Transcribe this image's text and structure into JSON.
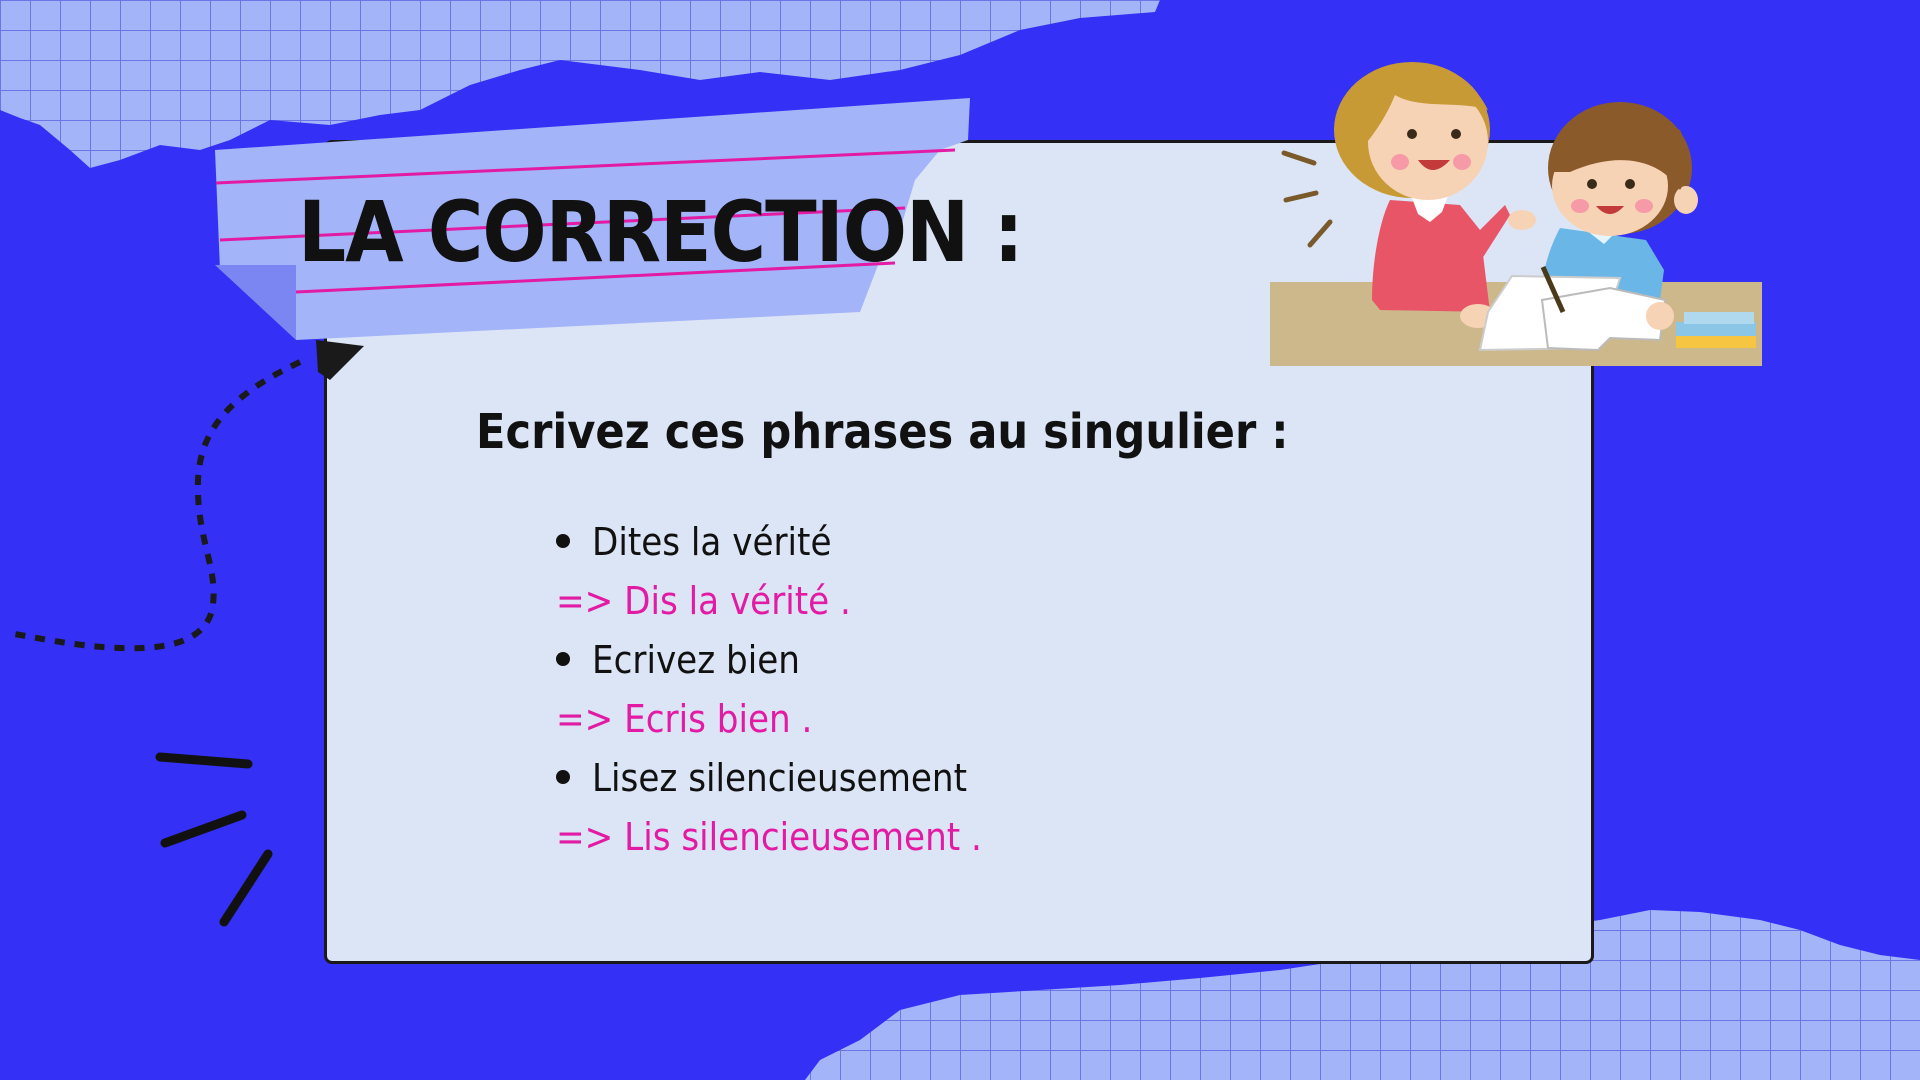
{
  "slide": {
    "title": "LA CORRECTION :",
    "instruction": "Ecrivez ces phrases au singulier :",
    "exercises": [
      {
        "sentence": "Dites la vérité",
        "answer": "=> Dis la vérité ."
      },
      {
        "sentence": "Ecrivez bien",
        "answer": "=> Ecris bien ."
      },
      {
        "sentence": "Lisez silencieusement",
        "answer": "=> Lis silencieusement ."
      }
    ]
  },
  "colors": {
    "background": "#3430f5",
    "card": "#dbe5f5",
    "grid_paper": "#a3b4f8",
    "answer_text": "#e21aa4",
    "ruled_line": "#e21aa4"
  },
  "icons": [
    "teacher-and-child-illustration",
    "dotted-arrow-decoration",
    "burst-lines-decoration",
    "grid-paper-decoration"
  ]
}
